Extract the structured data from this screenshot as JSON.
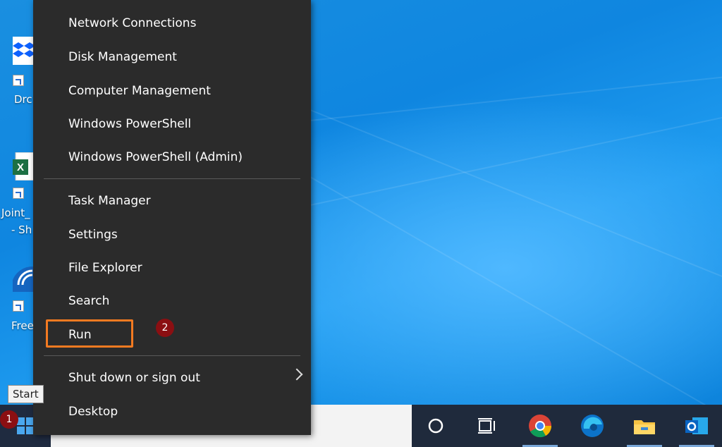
{
  "menu": {
    "items_top": [
      "Network Connections",
      "Disk Management",
      "Computer Management",
      "Windows PowerShell",
      "Windows PowerShell (Admin)"
    ],
    "items_mid": [
      "Task Manager",
      "Settings",
      "File Explorer",
      "Search",
      "Run"
    ],
    "items_bottom": [
      "Shut down or sign out",
      "Desktop"
    ]
  },
  "desktop_icons": [
    {
      "label": "Drc",
      "icon": "dropbox-icon"
    },
    {
      "label_line1": "Joint_",
      "label_line2": "- Sh",
      "icon": "excel-icon"
    },
    {
      "label": "Free",
      "icon": "wifi-icon"
    }
  ],
  "tooltip": {
    "start": "Start"
  },
  "badges": {
    "step1": "1",
    "step2": "2"
  },
  "taskbar": {
    "apps": [
      "cortana-icon",
      "task-view-icon",
      "chrome-icon",
      "edge-icon",
      "file-explorer-icon",
      "outlook-icon"
    ]
  },
  "colors": {
    "menu_bg": "#2b2b2b",
    "highlight": "#f37a21",
    "badge": "#8b0f12",
    "desktop": "#1a8fe0"
  }
}
